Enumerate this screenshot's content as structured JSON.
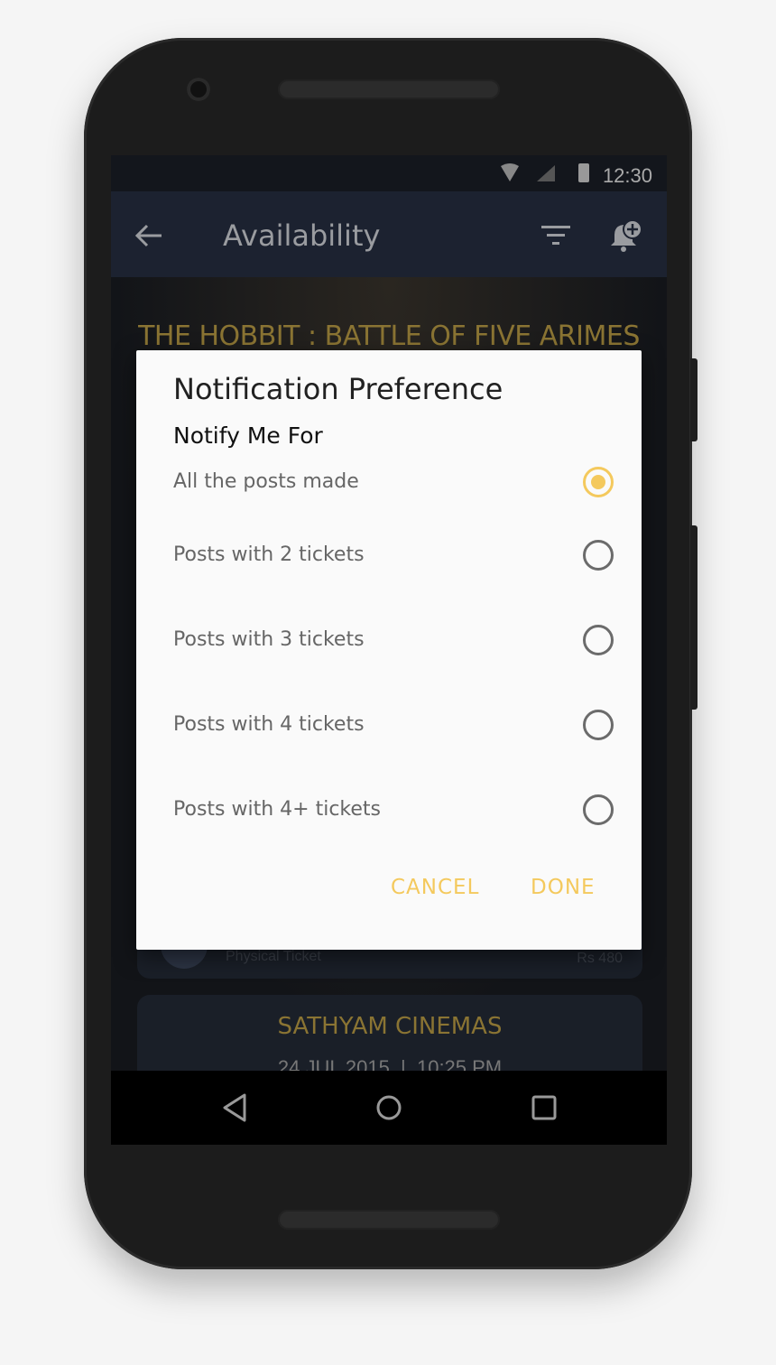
{
  "status_bar": {
    "time": "12:30"
  },
  "app_bar": {
    "title": "Availability",
    "icons": [
      "back-arrow-icon",
      "filter-icon",
      "bell-add-icon"
    ]
  },
  "content": {
    "movie_title": "THE HOBBIT : BATTLE OF FIVE ARIMES",
    "ticket": {
      "type": "Physical Ticket",
      "price": "Rs 480"
    },
    "theatre": {
      "name": "SATHYAM CINEMAS",
      "datetime": "24 JUL 2015  |  10:25 PM"
    }
  },
  "dialog": {
    "title": "Notification Preference",
    "subtitle": "Notify Me For",
    "options": [
      {
        "label": "All the posts made",
        "selected": true
      },
      {
        "label": "Posts with 2 tickets",
        "selected": false
      },
      {
        "label": "Posts with 3 tickets",
        "selected": false
      },
      {
        "label": "Posts with 4 tickets",
        "selected": false
      },
      {
        "label": "Posts with 4+ tickets",
        "selected": false
      }
    ],
    "cancel": "CANCEL",
    "done": "DONE"
  },
  "colors": {
    "accent": "#f4c95d",
    "gold": "#8a7433",
    "appbar": "#1c2230"
  }
}
